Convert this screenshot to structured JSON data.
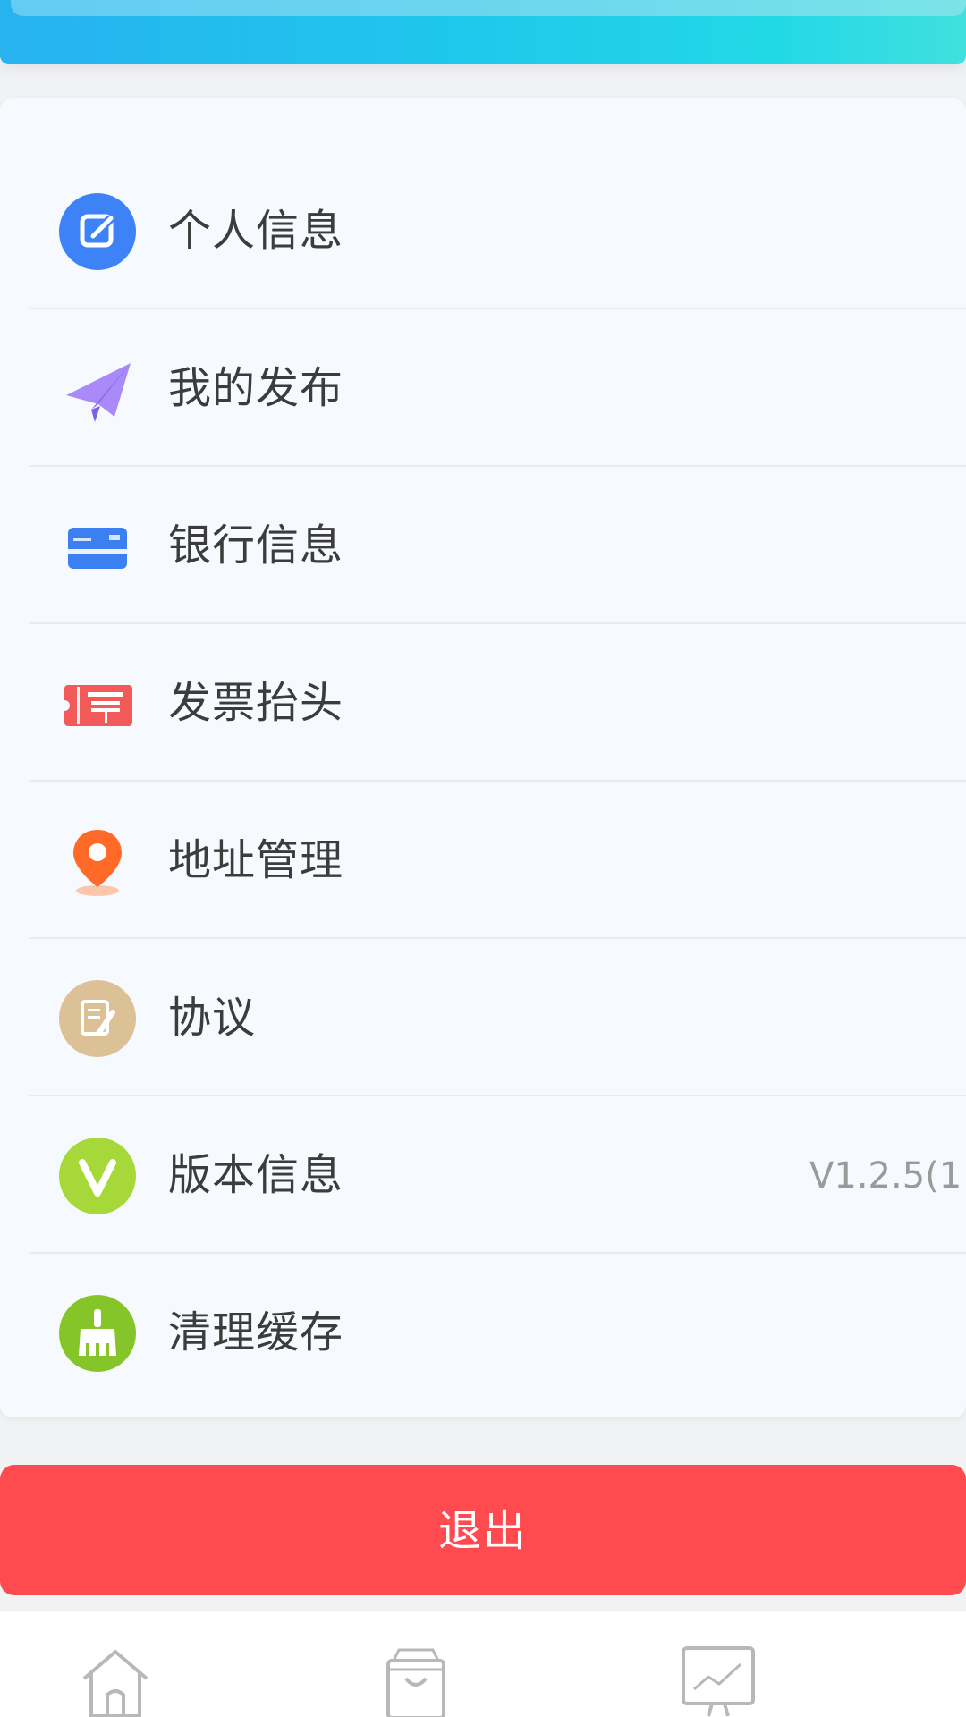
{
  "menu": {
    "items": [
      {
        "label": "个人信息",
        "icon": "edit-icon",
        "color": "#3e82f7"
      },
      {
        "label": "我的发布",
        "icon": "paper-plane-icon",
        "color": "#9b7bf5"
      },
      {
        "label": "银行信息",
        "icon": "bank-card-icon",
        "color": "#3b7ff0"
      },
      {
        "label": "发票抬头",
        "icon": "invoice-ticket-icon",
        "color": "#f25a5a"
      },
      {
        "label": "地址管理",
        "icon": "location-pin-icon",
        "color": "#ff6a28"
      },
      {
        "label": "协议",
        "icon": "agreement-document-icon",
        "color": "#d8b98a"
      },
      {
        "label": "版本信息",
        "icon": "version-v-icon",
        "color": "#a6d83a",
        "value": "V1.2.5(1"
      },
      {
        "label": "清理缓存",
        "icon": "broom-icon",
        "color": "#86c52a"
      }
    ]
  },
  "logout": {
    "label": "退出",
    "color": "#ff4a50"
  },
  "tabbar": {
    "tabs": [
      {
        "icon": "home-icon"
      },
      {
        "icon": "shopping-bag-icon"
      },
      {
        "icon": "monitor-chart-icon"
      }
    ]
  }
}
